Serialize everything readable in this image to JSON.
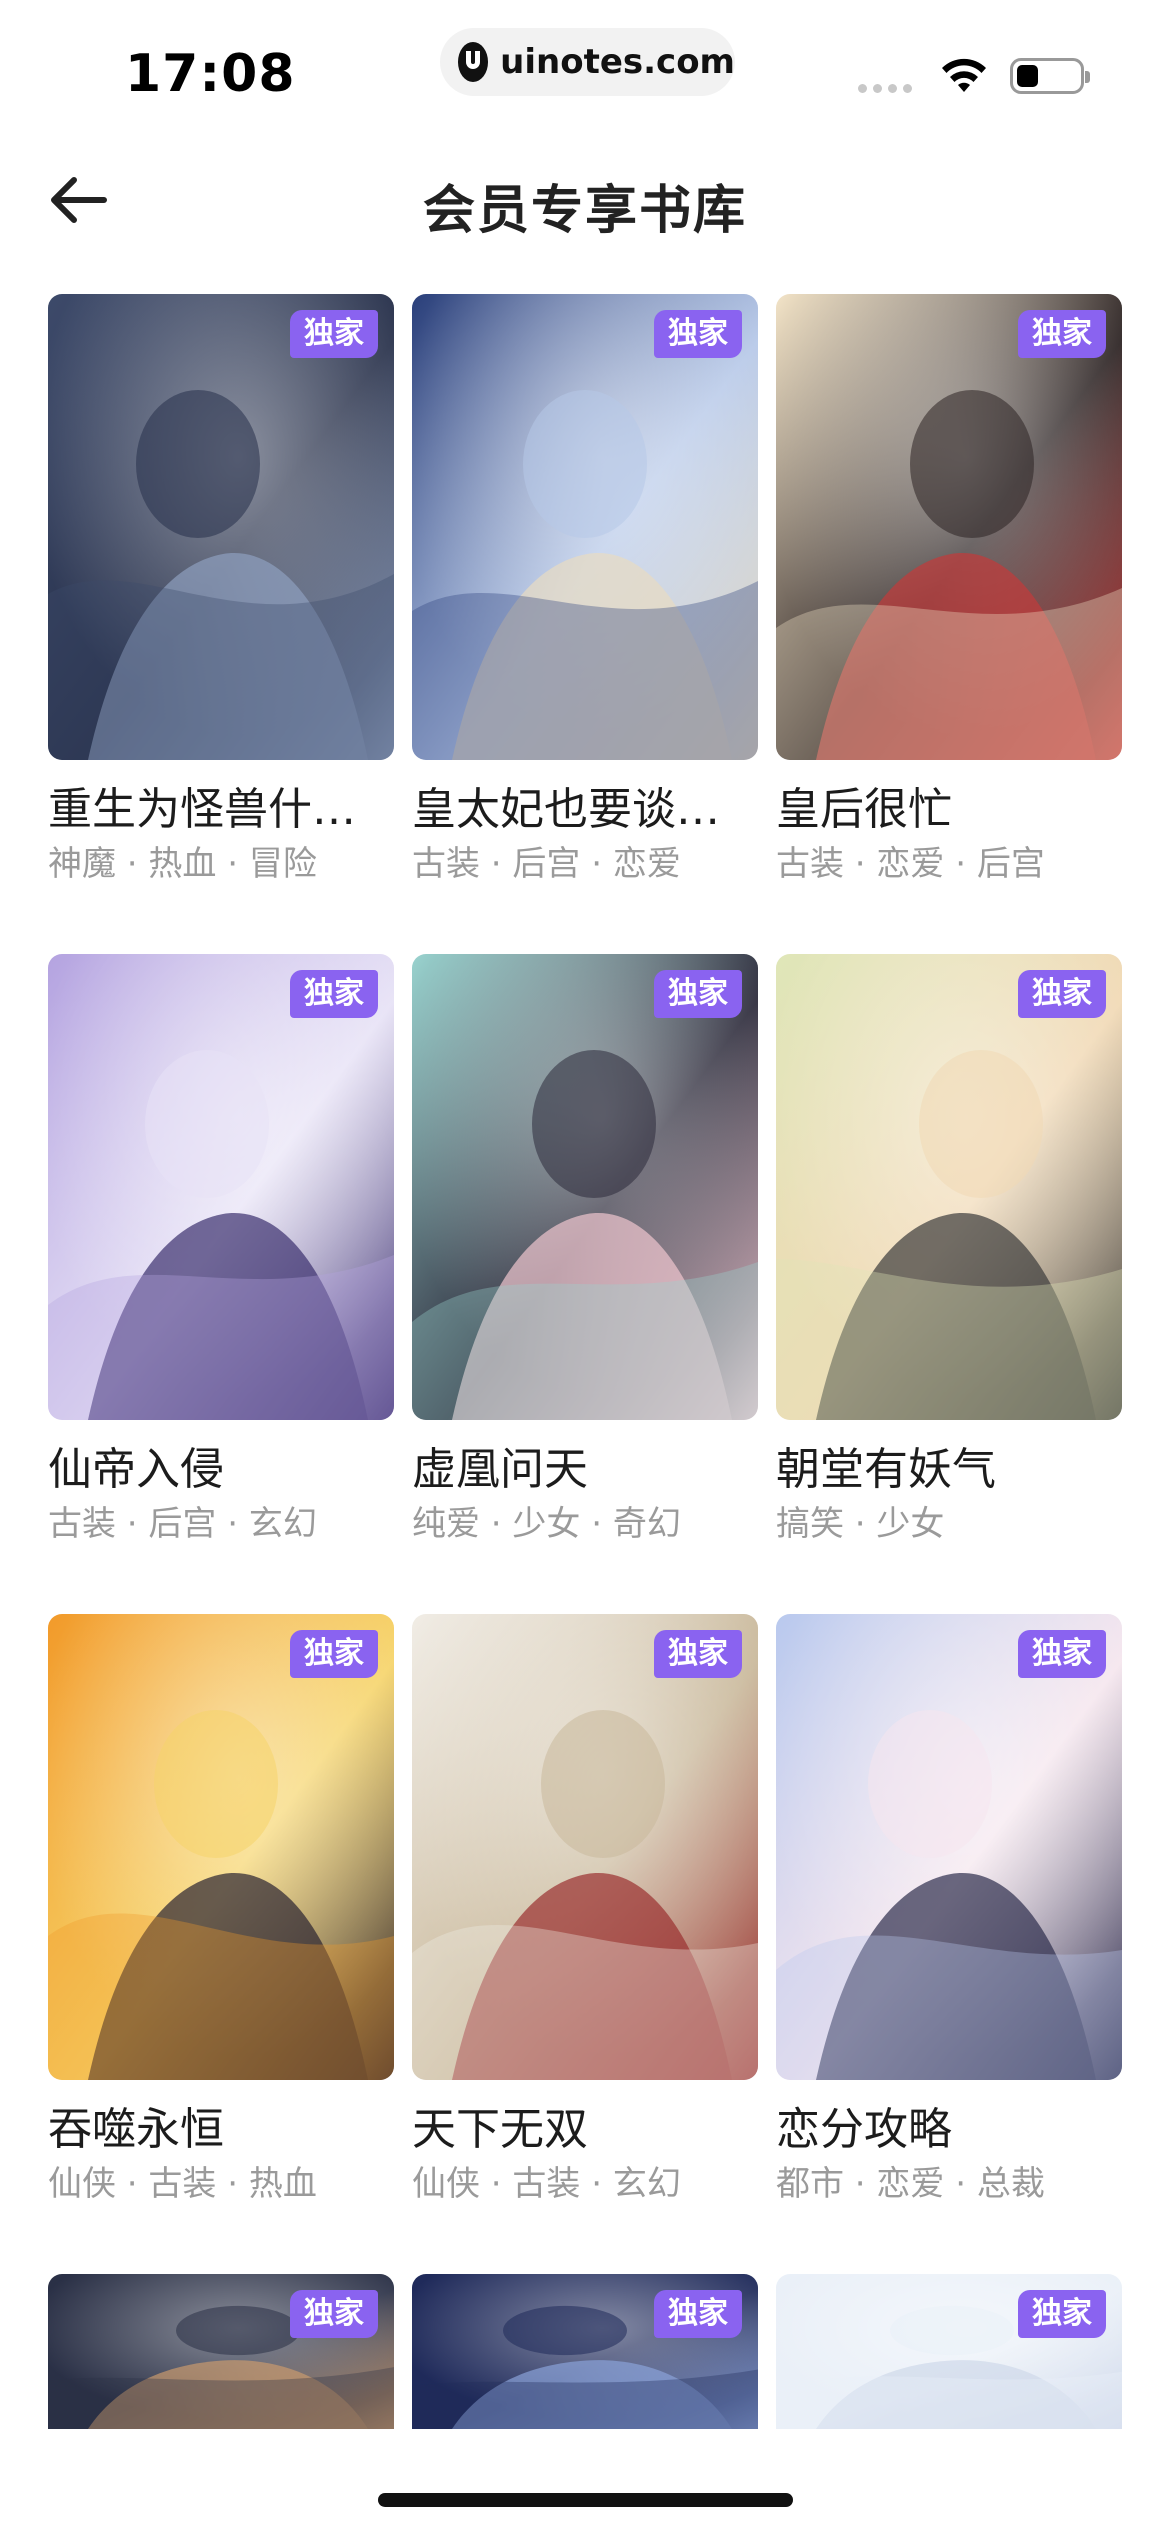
{
  "status_bar": {
    "time": "17:08",
    "url": "uinotes.com",
    "battery_level": 0.35
  },
  "header": {
    "title": "会员专享书库",
    "back_icon": "arrow-left-icon"
  },
  "colors": {
    "badge": "#8a63f0",
    "tag_text": "#9a9a9a"
  },
  "books": [
    {
      "title": "重生为怪兽什…",
      "tags": "神魔 · 热血 · 冒险",
      "badge": "独家",
      "palette": [
        "#3d4a6a",
        "#8fa0bf",
        "#27304a"
      ]
    },
    {
      "title": "皇太妃也要谈…",
      "tags": "古装 · 后宫 · 恋爱",
      "badge": "独家",
      "palette": [
        "#2a3f7a",
        "#e8dcc2",
        "#b6c8e8"
      ]
    },
    {
      "title": "皇后很忙",
      "tags": "古装 · 恋爱 · 后宫",
      "badge": "独家",
      "palette": [
        "#f3e4c8",
        "#c33b3b",
        "#2b2222"
      ]
    },
    {
      "title": "仙帝入侵",
      "tags": "古装 · 后宫 · 玄幻",
      "badge": "独家",
      "palette": [
        "#b4a3e0",
        "#3b2f6e",
        "#e7e2f6"
      ]
    },
    {
      "title": "虚凰问天",
      "tags": "纯爱 · 少女 · 奇幻",
      "badge": "独家",
      "palette": [
        "#9ad3cf",
        "#f0c6cf",
        "#2c2a3a"
      ]
    },
    {
      "title": "朝堂有妖气",
      "tags": "搞笑 · 少女",
      "badge": "独家",
      "palette": [
        "#dfe6b8",
        "#3a3a3a",
        "#f1d9b5"
      ]
    },
    {
      "title": "吞噬永恒",
      "tags": "仙侠 · 古装 · 热血",
      "badge": "独家",
      "palette": [
        "#f29a2a",
        "#2a2230",
        "#f6d46a"
      ]
    },
    {
      "title": "天下无双",
      "tags": "仙侠 · 古装 · 玄幻",
      "badge": "独家",
      "palette": [
        "#f1ede6",
        "#9a2f2f",
        "#c9b89a"
      ]
    },
    {
      "title": "恋分攻略",
      "tags": "都市 · 恋爱 · 总裁",
      "badge": "独家",
      "palette": [
        "#b9c9ee",
        "#2c2c4c",
        "#f5e6ee"
      ]
    }
  ],
  "partial_row": [
    {
      "badge": "独家",
      "palette": [
        "#2a3046",
        "#c99a6e"
      ]
    },
    {
      "badge": "独家",
      "palette": [
        "#1f2a5a",
        "#8aa2d8"
      ]
    },
    {
      "badge": "独家",
      "palette": [
        "#eaf0f8",
        "#cfd8ea"
      ]
    }
  ]
}
